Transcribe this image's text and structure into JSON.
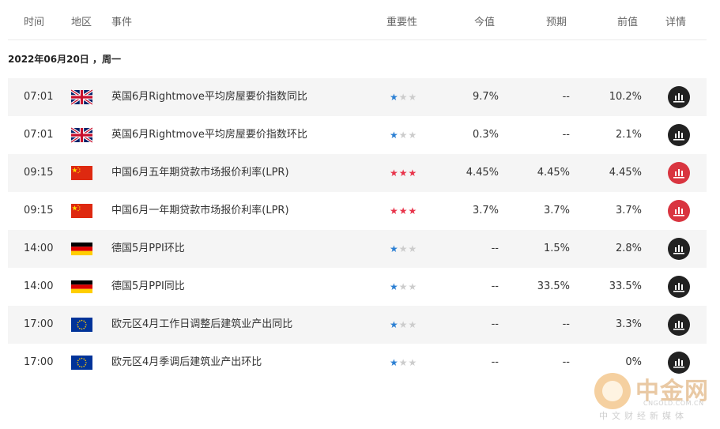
{
  "columns": {
    "time": "时间",
    "region": "地区",
    "event": "事件",
    "importance": "重要性",
    "actual": "今值",
    "forecast": "预期",
    "previous": "前值",
    "detail": "详情"
  },
  "date_label": "2022年06月20日 ，周一",
  "rows": [
    {
      "time": "07:01",
      "flag": "uk-flag-icon",
      "event": "英国6月Rightmove平均房屋要价指数同比",
      "stars": 1,
      "star_color": "#2b7fd3",
      "actual": "9.7%",
      "forecast": "--",
      "previous": "10.2%",
      "detail_color": "#222222"
    },
    {
      "time": "07:01",
      "flag": "uk-flag-icon",
      "event": "英国6月Rightmove平均房屋要价指数环比",
      "stars": 1,
      "star_color": "#2b7fd3",
      "actual": "0.3%",
      "forecast": "--",
      "previous": "2.1%",
      "detail_color": "#222222"
    },
    {
      "time": "09:15",
      "flag": "china-flag-icon",
      "event": "中国6月五年期贷款市场报价利率(LPR)",
      "stars": 3,
      "star_color": "#e8334a",
      "actual": "4.45%",
      "forecast": "4.45%",
      "previous": "4.45%",
      "detail_color": "#d93540"
    },
    {
      "time": "09:15",
      "flag": "china-flag-icon",
      "event": "中国6月一年期贷款市场报价利率(LPR)",
      "stars": 3,
      "star_color": "#e8334a",
      "actual": "3.7%",
      "forecast": "3.7%",
      "previous": "3.7%",
      "detail_color": "#d93540"
    },
    {
      "time": "14:00",
      "flag": "germany-flag-icon",
      "event": "德国5月PPI环比",
      "stars": 1,
      "star_color": "#2b7fd3",
      "actual": "--",
      "forecast": "1.5%",
      "previous": "2.8%",
      "detail_color": "#222222"
    },
    {
      "time": "14:00",
      "flag": "germany-flag-icon",
      "event": "德国5月PPI同比",
      "stars": 1,
      "star_color": "#2b7fd3",
      "actual": "--",
      "forecast": "33.5%",
      "previous": "33.5%",
      "detail_color": "#222222"
    },
    {
      "time": "17:00",
      "flag": "eu-flag-icon",
      "event": "欧元区4月工作日调整后建筑业产出同比",
      "stars": 1,
      "star_color": "#2b7fd3",
      "actual": "--",
      "forecast": "--",
      "previous": "3.3%",
      "detail_color": "#222222"
    },
    {
      "time": "17:00",
      "flag": "eu-flag-icon",
      "event": "欧元区4月季调后建筑业产出环比",
      "stars": 1,
      "star_color": "#2b7fd3",
      "actual": "--",
      "forecast": "--",
      "previous": "0%",
      "detail_color": "#222222"
    }
  ],
  "watermark": {
    "title": "中金网",
    "url": "CNGOLD.COM.CN",
    "subtitle": "中文财经新媒体"
  }
}
